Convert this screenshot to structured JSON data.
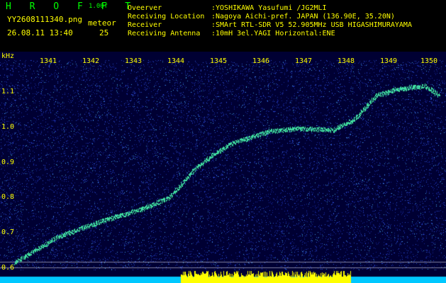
{
  "header": {
    "brand": "H R O F F T",
    "version": "1.00f",
    "filename": "YY2608111340.png",
    "datetime": "26.08.11 13:40",
    "meteor_label": "meteor",
    "meteor_count": "25",
    "fields": [
      {
        "key": "Oveerver",
        "value": ":YOSHIKAWA Yasufumi /JG2MLI"
      },
      {
        "key": "Receiving Location",
        "value": ":Nagoya Aichi-pref. JAPAN (136.90E, 35.20N)"
      },
      {
        "key": "Receiver",
        "value": ":SMArt RTL-SDR V5 52.905MHz USB HIGASHIMURAYAMA"
      },
      {
        "key": "Receiving Antenna",
        "value": ":10mH 3el.YAGI Horizontal:ENE"
      }
    ]
  },
  "spectrogram": {
    "y_unit": "kHz",
    "y_ticks": [
      "1.1",
      "1.0",
      "0.9",
      "0.8",
      "0.7",
      "0.6"
    ],
    "x_ticks": [
      "1341",
      "1342",
      "1343",
      "1344",
      "1345",
      "1346",
      "1347",
      "1348",
      "1349",
      "1350"
    ],
    "colors": {
      "background": "#000033",
      "noise": "#2040c0",
      "trace": "#40e0a0",
      "bottom_bar": "#00c8ff",
      "burst": "#ffff00"
    }
  }
}
